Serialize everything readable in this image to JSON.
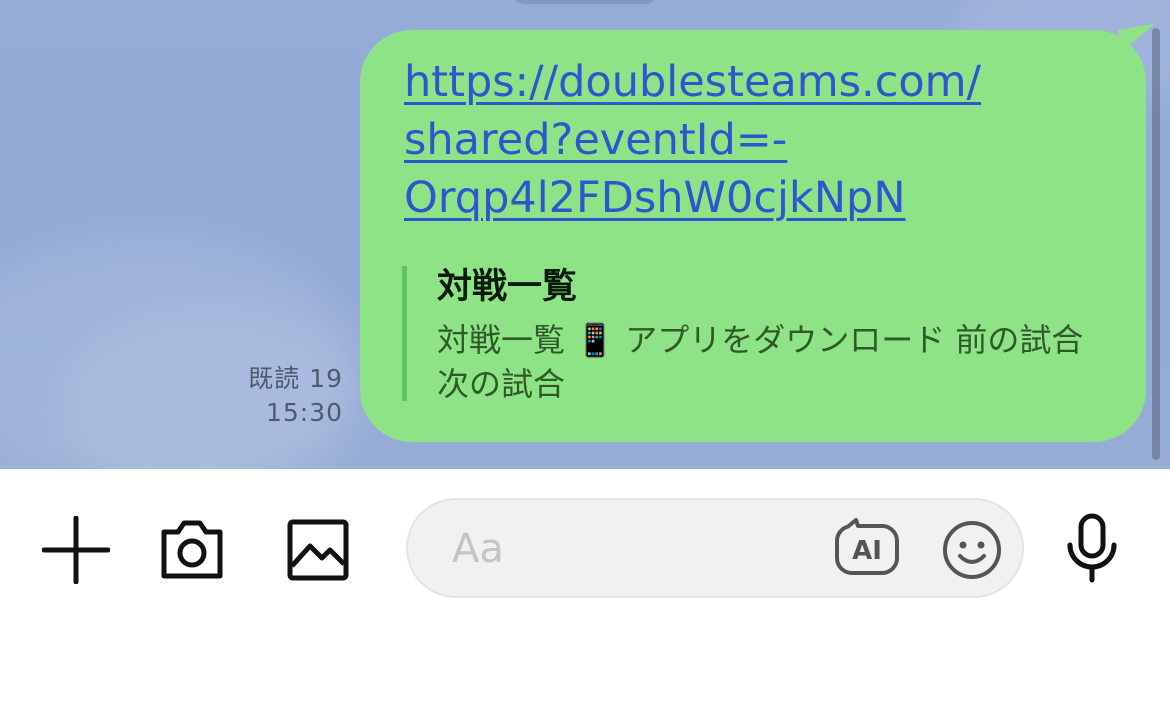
{
  "message": {
    "read_status": "既読 19",
    "time": "15:30",
    "link_lines": [
      "https://doublesteams.com/",
      "shared?eventId=-",
      "Orqp4l2FDshW0cjkNpN"
    ],
    "preview": {
      "title": "対戦一覧",
      "description": "対戦一覧 📱 アプリをダウンロード 前の試合 次の試合"
    }
  },
  "composer": {
    "placeholder": "Aa",
    "ai_label": "AI"
  },
  "icons": {
    "plus": "plus-icon",
    "camera": "camera-icon",
    "image": "image-icon",
    "ai": "ai-icon",
    "emoji": "emoji-icon",
    "mic": "microphone-icon"
  },
  "colors": {
    "chat_background": "#95abd8",
    "bubble": "#8ee386",
    "link": "#2d56cf"
  }
}
